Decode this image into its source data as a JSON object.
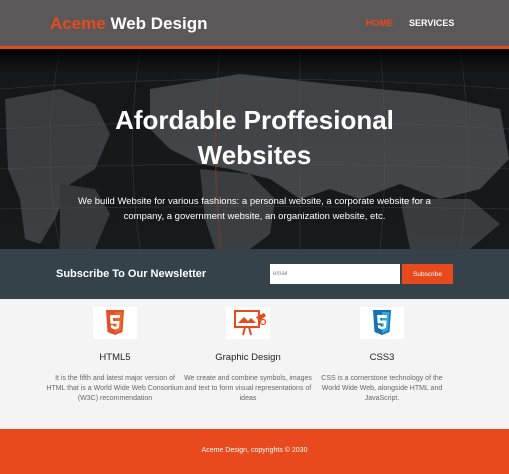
{
  "header": {
    "brand_highlight": "Aceme",
    "brand_rest": " Web Design",
    "nav": {
      "home": "HOME",
      "services": "SERVICES"
    }
  },
  "showcase": {
    "title_line1": "Afordable Proffesional",
    "title_line2": "Websites",
    "text": "We build Website for various fashions: a personal website, a corporate website for a company, a government website, an organization website, etc."
  },
  "newsletter": {
    "title": "Subscribe To Our Newsletter",
    "email_placeholder": "email",
    "subscribe_label": "Subscribe"
  },
  "boxes": [
    {
      "icon": "html5-logo-icon",
      "title": "HTML5",
      "text": "It is the fifth and latest major version of HTML that is a World Wide Web Consortium (W3C) recommendation"
    },
    {
      "icon": "graphic-design-icon",
      "title": "Graphic Design",
      "text": "We create and combine symbols, images and text to form visual representations of ideas"
    },
    {
      "icon": "css3-logo-icon",
      "title": "CSS3",
      "text": "CSS is a cornerstone technology of the World Wide Web, alongside HTML and JavaScript."
    }
  ],
  "footer": {
    "text": "Aceme Design, copyrights © 2030"
  },
  "colors": {
    "accent": "#e8491d",
    "header_bg": "#5a5858",
    "newsletter_bg": "#35424a",
    "background": "#f4f4f4"
  }
}
